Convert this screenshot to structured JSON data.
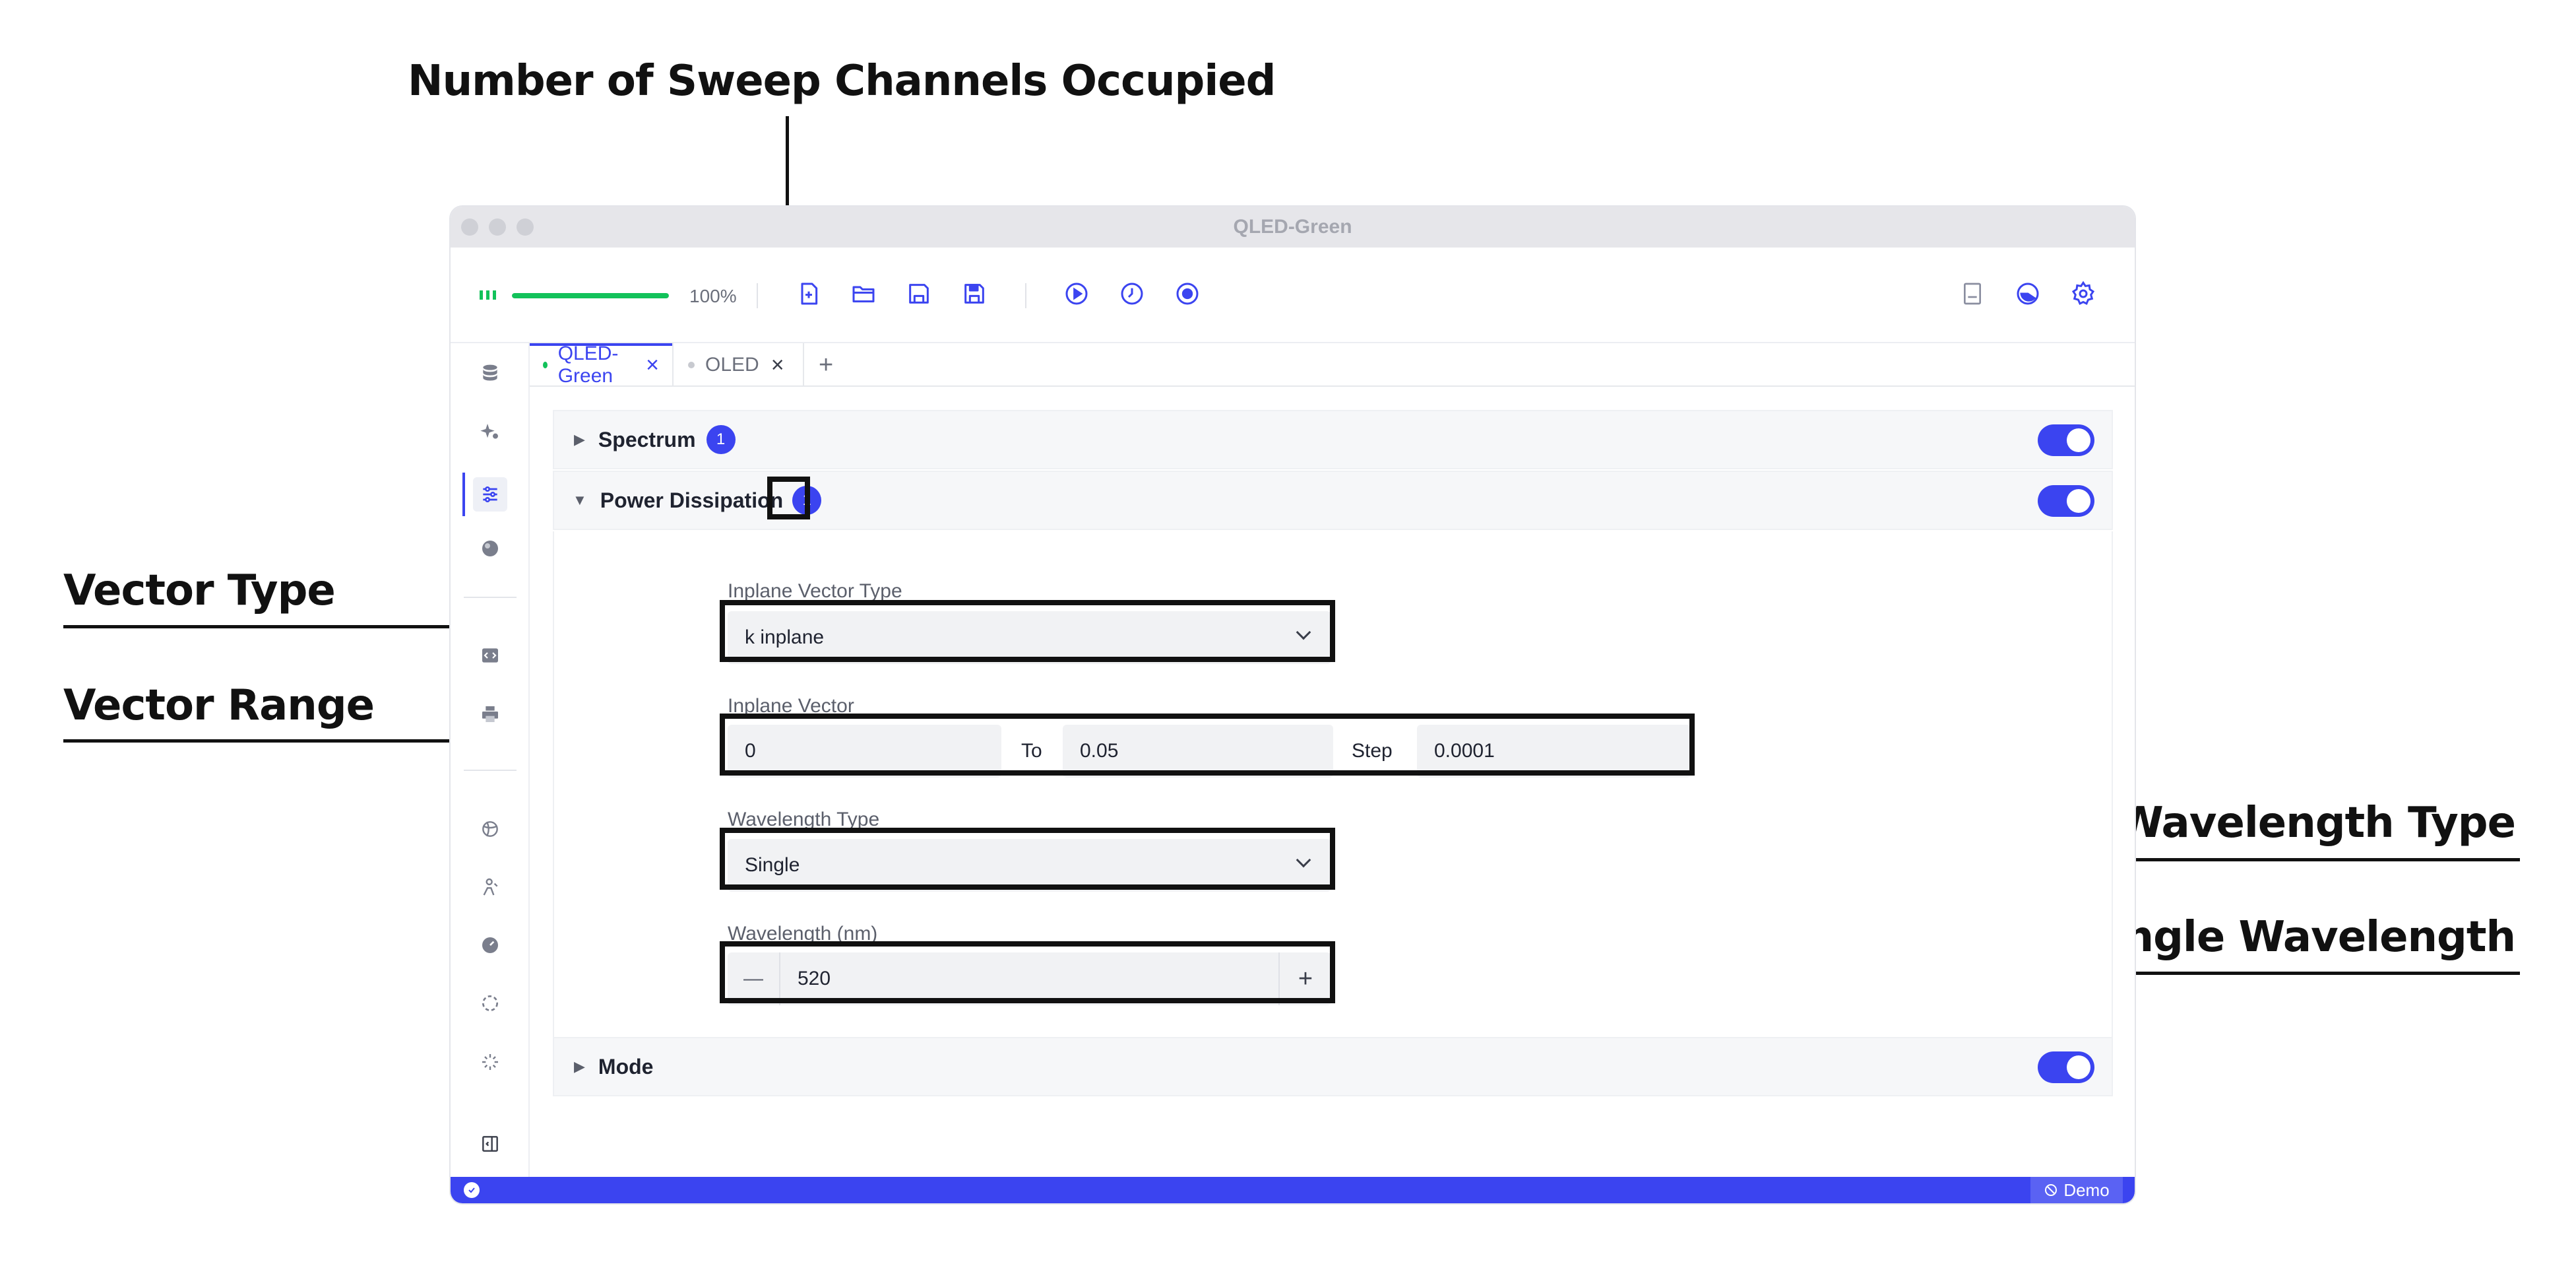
{
  "callouts": {
    "sweep_channels": "Number of Sweep Channels Occupied",
    "vector_type": "Vector Type",
    "vector_range": "Vector Range",
    "wavelength_type": "Wavelength Type",
    "single_wavelength": "Single Wavelength"
  },
  "window": {
    "title": "QLED-Green"
  },
  "toolbar": {
    "progress_percent": 100,
    "progress_label": "100%",
    "progress_color": "#12c25a",
    "icons": [
      "new-file-icon",
      "open-folder-icon",
      "save-icon",
      "save-as-icon",
      "run-icon",
      "timer-icon",
      "record-icon",
      "notes-icon",
      "theme-icon",
      "settings-icon"
    ]
  },
  "sidebar": {
    "icons": [
      "database-icon",
      "sparkle-icon",
      "sliders-icon",
      "sphere-icon",
      "code-icon",
      "printer-icon",
      "globe-icon",
      "person-icon",
      "gauge-icon",
      "loader-icon",
      "sun-icon",
      "collapse-panel-icon"
    ],
    "active": "sliders-icon"
  },
  "tabs": [
    {
      "label": "QLED-Green",
      "active": true,
      "dot_color": "#12c25a"
    },
    {
      "label": "OLED",
      "active": false,
      "dot_color": "#c8cad0"
    }
  ],
  "add_tab_symbol": "+",
  "panels": {
    "spectrum": {
      "title": "Spectrum",
      "badge": "1",
      "enabled": true
    },
    "power_dissipation": {
      "title": "Power Dissipation",
      "badge": "1",
      "enabled": true
    },
    "mode": {
      "title": "Mode",
      "enabled": true
    }
  },
  "form": {
    "inplane_vector_type": {
      "label": "Inplane Vector Type",
      "value": "k inplane"
    },
    "inplane_vector": {
      "label": "Inplane Vector",
      "from": "0",
      "to_label": "To",
      "to": "0.05",
      "step_label": "Step",
      "step": "0.0001"
    },
    "wavelength_type": {
      "label": "Wavelength Type",
      "value": "Single"
    },
    "wavelength": {
      "label": "Wavelength (nm)",
      "value": "520",
      "minus": "—",
      "plus": "+"
    }
  },
  "statusbar": {
    "demo_label": "Demo",
    "accent": "#3b44f0"
  }
}
